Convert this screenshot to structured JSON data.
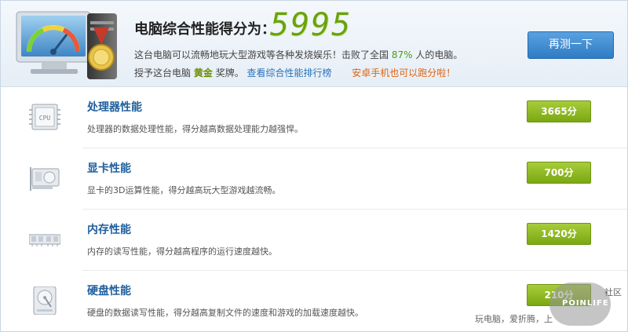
{
  "header": {
    "score_label": "电脑综合性能得分为：",
    "score_value": "5995",
    "line1_prefix": "这台电脑可以流畅地玩大型游戏等各种发烧娱乐！击败了全国",
    "line1_percent": "87%",
    "line1_suffix": "人的电脑。",
    "line2_prefix": "授予这台电脑",
    "line2_medal": "黄金",
    "line2_award": "奖牌。",
    "line2_link": "查看综合性能排行榜",
    "line2_mobile": "安卓手机也可以跑分啦！",
    "retest_label": "再测一下"
  },
  "rows": [
    {
      "title": "处理器性能",
      "desc": "处理器的数据处理性能，得分越高数据处理能力越强悍。",
      "score": "3665分",
      "icon_label": "CPU"
    },
    {
      "title": "显卡性能",
      "desc": "显卡的3D运算性能，得分越高玩大型游戏越流畅。",
      "score": "700分"
    },
    {
      "title": "内存性能",
      "desc": "内存的读写性能，得分越高程序的运行速度越快。",
      "score": "1420分"
    },
    {
      "title": "硬盘性能",
      "desc": "硬盘的数据读写性能，得分越高复制文件的速度和游戏的加载速度越快。",
      "score": "210分"
    }
  ],
  "watermark": {
    "brand": "POINLIFE",
    "community": "社区",
    "slogan": "玩电脑，爱折腾，上"
  },
  "icons": [
    "monitor-gauge-icon",
    "medal-icon",
    "cpu-icon",
    "gpu-icon",
    "memory-icon",
    "hdd-icon"
  ],
  "colors": {
    "score_green": "#6aa30a",
    "pill_green": "#8ab820",
    "button_blue": "#3b86cf",
    "title_blue": "#1f5f9c",
    "warn_orange": "#e0620d"
  }
}
